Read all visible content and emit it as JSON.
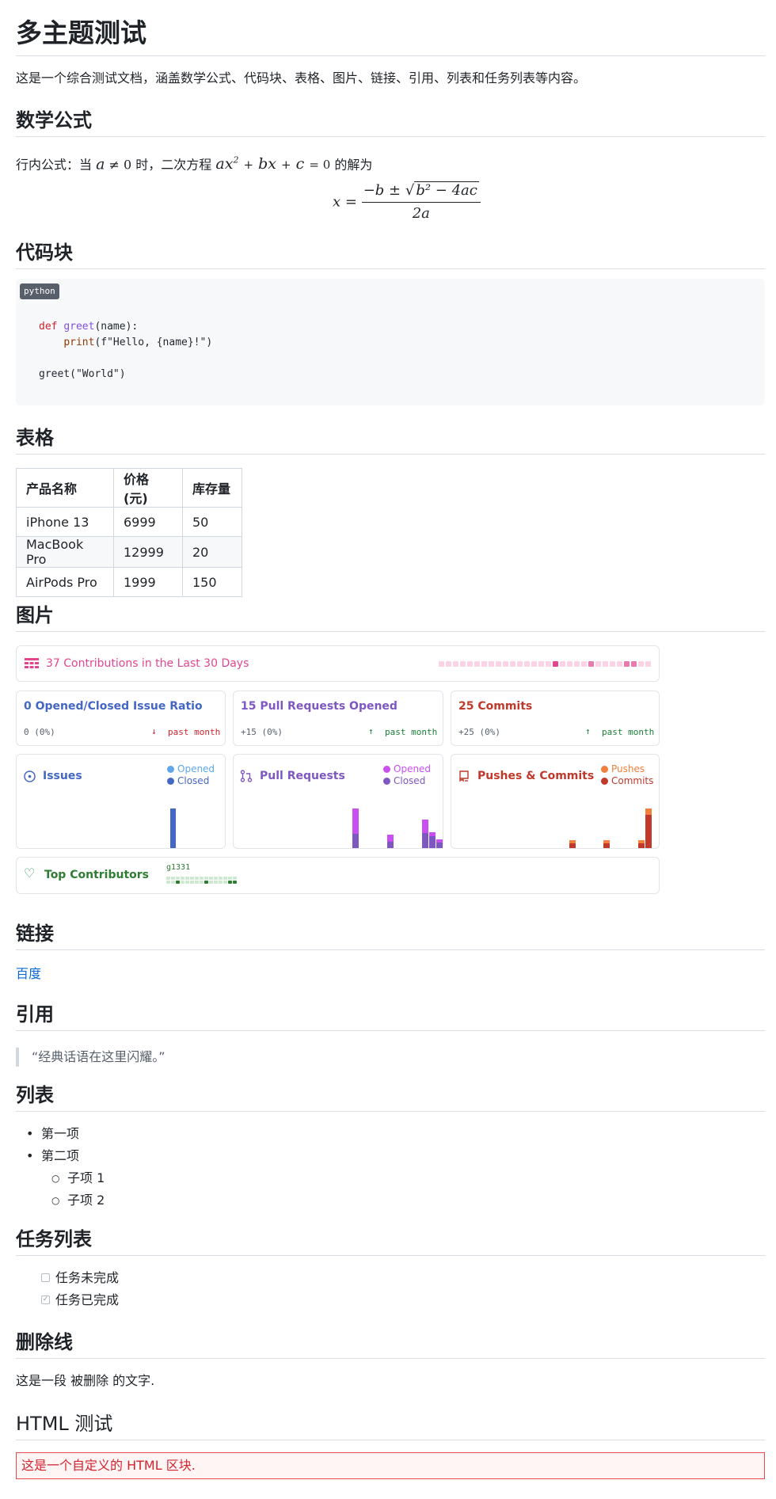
{
  "doc": {
    "title": "多主题测试",
    "intro": "这是一个综合测试文档，涵盖数学公式、代码块、表格、图片、链接、引用、列表和任务列表等内容。"
  },
  "math": {
    "heading": "数学公式",
    "inline_prefix": "行内公式：当",
    "cond_var": "a",
    "cond_op": " ≠ 0",
    "inline_mid": "时，二次方程",
    "inline_suffix": "的解为",
    "display_lhs": "x =",
    "numerator": "−b ± ",
    "sqrt_body": "b² − 4ac",
    "denominator": "2a"
  },
  "code": {
    "heading": "代码块",
    "lang": "python",
    "line1_kw": "def",
    "line1_fn": "greet",
    "line1_rest": "(name):",
    "line2_indent": "    ",
    "line2_bi": "print",
    "line2_rest": "(f\"Hello, {name}!\")",
    "line3": "greet(\"World\")"
  },
  "table": {
    "heading": "表格",
    "headers": [
      "产品名称",
      "价格(元)",
      "库存量"
    ],
    "rows": [
      [
        "iPhone 13",
        "6999",
        "50"
      ],
      [
        "MacBook Pro",
        "12999",
        "20"
      ],
      [
        "AirPods Pro",
        "1999",
        "150"
      ]
    ]
  },
  "images": {
    "heading": "图片",
    "contrib_title": "37 Contributions in the Last 30 Days",
    "issue_ratio": {
      "title": "0 Opened/Closed Issue Ratio",
      "stat": "0 (0%)",
      "trend": "past month"
    },
    "prs_opened": {
      "title": "15 Pull Requests Opened",
      "stat": "+15 (0%)",
      "trend": "past month"
    },
    "commits": {
      "title": "25 Commits",
      "stat": "+25 (0%)",
      "trend": "past month"
    },
    "issues_card": {
      "title": "Issues",
      "legend": [
        "Opened",
        "Closed"
      ]
    },
    "prs_card": {
      "title": "Pull Requests",
      "legend": [
        "Opened",
        "Closed"
      ]
    },
    "pushes_card": {
      "title": "Pushes & Commits",
      "legend": [
        "Pushes",
        "Commits"
      ]
    },
    "top_contrib": {
      "title": "Top Contributors",
      "user": "g1331"
    },
    "colors": {
      "pink": "#e4468e",
      "blue": "#4467c4",
      "purple": "#7e57c2",
      "magenta": "#c94ff0",
      "red": "#c0392b",
      "orange": "#f0803c",
      "green": "#2e7d32"
    }
  },
  "links": {
    "heading": "链接",
    "baidu": "百度"
  },
  "quote": {
    "heading": "引用",
    "text": "“经典话语在这里闪耀。”"
  },
  "list": {
    "heading": "列表",
    "items": [
      "第一项",
      "第二项"
    ],
    "sub_items": [
      "子项 1",
      "子项 2"
    ]
  },
  "tasks": {
    "heading": "任务列表",
    "items": [
      {
        "label": "任务未完成",
        "done": false
      },
      {
        "label": "任务已完成",
        "done": true
      }
    ]
  },
  "strike": {
    "heading": "删除线",
    "text": "这是一段 被删除 的文字."
  },
  "html_test": {
    "heading": "HTML 测试",
    "box": "这是一个自定义的 HTML 区块."
  }
}
